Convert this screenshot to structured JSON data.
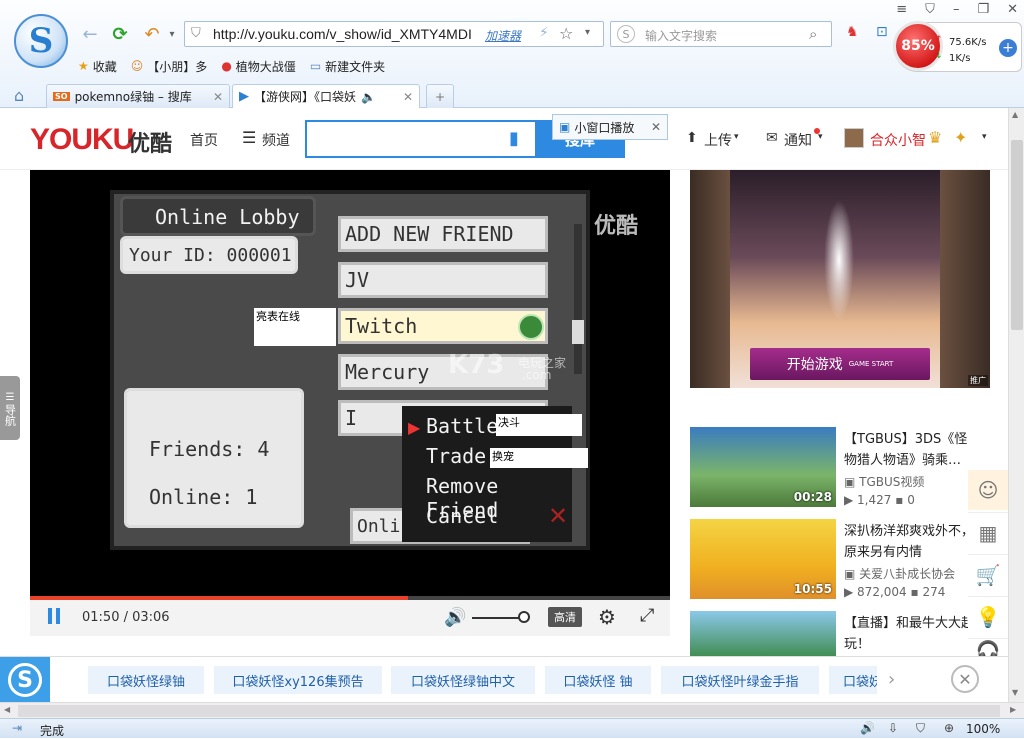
{
  "browser": {
    "url": "http://v.youku.com/v_show/id_XMTY4MDI",
    "accelerator_label": "加速器",
    "search_placeholder": "输入文字搜索",
    "bookmarks": [
      {
        "label": "收藏",
        "icon": "star-icon"
      },
      {
        "label": "【小朋】多",
        "icon": "face-icon"
      },
      {
        "label": "植物大战僵",
        "icon": "pin-icon"
      },
      {
        "label": "新建文件夹",
        "icon": "folder-icon"
      }
    ],
    "tabs": [
      {
        "label": "pokemno绿铀 – 搜库",
        "active": false
      },
      {
        "label": "【游侠网】《口袋妖",
        "active": true
      }
    ],
    "speed": {
      "percent": "85%",
      "up": "75.6K/s",
      "down": "1K/s"
    },
    "status_text": "完成",
    "zoom": "100%"
  },
  "youku": {
    "logo_en": "YOUKU",
    "logo_cn": "优酷",
    "nav_home": "首页",
    "nav_channel": "频道",
    "search_button": "搜库",
    "mini_window": "小窗口播放",
    "upload": "上传",
    "notify": "通知",
    "user_name": "合众小智"
  },
  "game": {
    "lobby_title": "Online Lobby",
    "your_id": "Your ID: 000001",
    "friends": "Friends: 4",
    "online": "Online: 1",
    "friend_list": [
      "ADD NEW FRIEND",
      "JV",
      "Twitch",
      "Mercury",
      "I"
    ],
    "bottom_id": "Online  013",
    "menu": [
      "Battle",
      "Trade",
      "Remove Friend",
      "Cancel"
    ],
    "subtitles": {
      "online": "亮表在线",
      "battle": "决斗",
      "trade": "换宠"
    },
    "watermark_youku": "优酷",
    "watermark_k73": "K73",
    "watermark_k73_cn": "电玩之家",
    "watermark_k73_com": ".com"
  },
  "player": {
    "time": "01:50 / 03:06",
    "progress_fraction": 0.59,
    "hd_label": "高清"
  },
  "ad": {
    "button": "开始游戏",
    "button_sub": "GAME START",
    "tag": "推广"
  },
  "videos": [
    {
      "title": "【TGBUS】3DS《怪物猎人物语》骑乘…",
      "source": "TGBUS视频",
      "views": "1,427",
      "comments": "0",
      "duration": "00:28"
    },
    {
      "title": "深扒杨洋郑爽戏外不，原来另有内情",
      "source": "关爱八卦成长协会",
      "views": "872,004",
      "comments": "274",
      "duration": "10:55"
    },
    {
      "title": "【直播】和最牛大大起玩！",
      "source": "",
      "views": "",
      "comments": "",
      "duration": ""
    }
  ],
  "left_nav": "导航",
  "suggestions": [
    "口袋妖怪绿铀",
    "口袋妖怪xy126集预告",
    "口袋妖怪绿铀中文",
    "口袋妖怪 铀",
    "口袋妖怪叶绿金手指",
    "口袋妖"
  ]
}
